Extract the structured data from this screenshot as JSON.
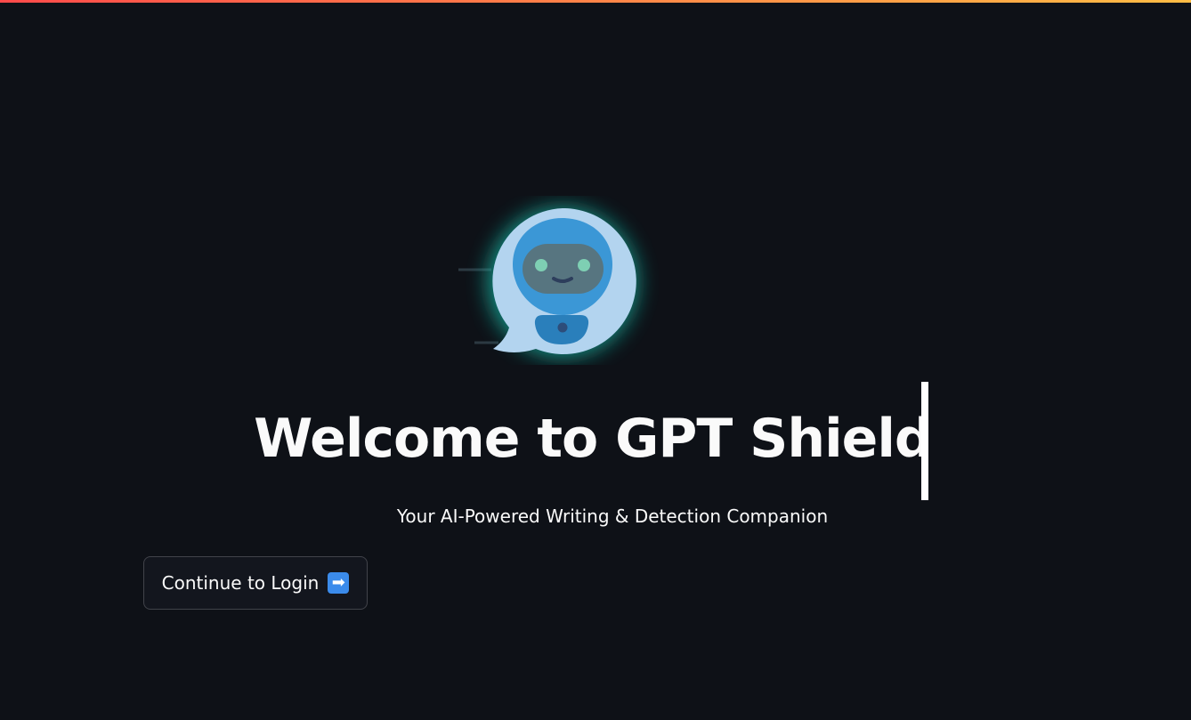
{
  "header": {
    "accent_gradient": [
      "#ff4b4b",
      "#ffbd45"
    ]
  },
  "hero": {
    "logo_icon": "robot-chat-bubble-icon",
    "title": "Welcome to GPT Shield",
    "subtitle": "Your AI-Powered Writing & Detection Companion"
  },
  "actions": {
    "continue_label": "Continue to Login",
    "continue_icon": "right-arrow-emoji-icon",
    "arrow_glyph": "➡"
  },
  "colors": {
    "background": "#0e1117",
    "glow": "#14b8a6",
    "bubble": "#b3d4ef",
    "robot_head": "#3b97d6"
  }
}
